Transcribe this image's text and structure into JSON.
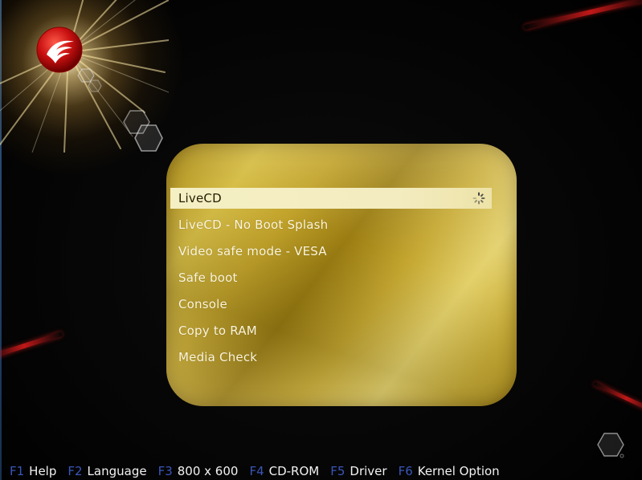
{
  "colors": {
    "panel_gold": "#c9ad38",
    "selected_bg": "#f5efc4",
    "item_text": "#fbf6dc",
    "selected_text": "#231c00",
    "fkey_key": "#3a56b8",
    "fkey_label": "#f2f2f2",
    "streak_red": "#c01818"
  },
  "icons": {
    "logo": "red-bird-logo-icon",
    "spinner": "loading-spinner-icon",
    "decor": "hexagon-icon"
  },
  "menu": {
    "items": [
      {
        "label": "LiveCD",
        "selected": true
      },
      {
        "label": "LiveCD - No Boot Splash",
        "selected": false
      },
      {
        "label": "Video safe mode - VESA",
        "selected": false
      },
      {
        "label": "Safe boot",
        "selected": false
      },
      {
        "label": "Console",
        "selected": false
      },
      {
        "label": "Copy to RAM",
        "selected": false
      },
      {
        "label": "Media Check",
        "selected": false
      }
    ]
  },
  "fkeys": [
    {
      "key": "F1",
      "label": "Help"
    },
    {
      "key": "F2",
      "label": "Language"
    },
    {
      "key": "F3",
      "label": "800 x 600"
    },
    {
      "key": "F4",
      "label": "CD-ROM"
    },
    {
      "key": "F5",
      "label": "Driver"
    },
    {
      "key": "F6",
      "label": "Kernel Option"
    }
  ]
}
